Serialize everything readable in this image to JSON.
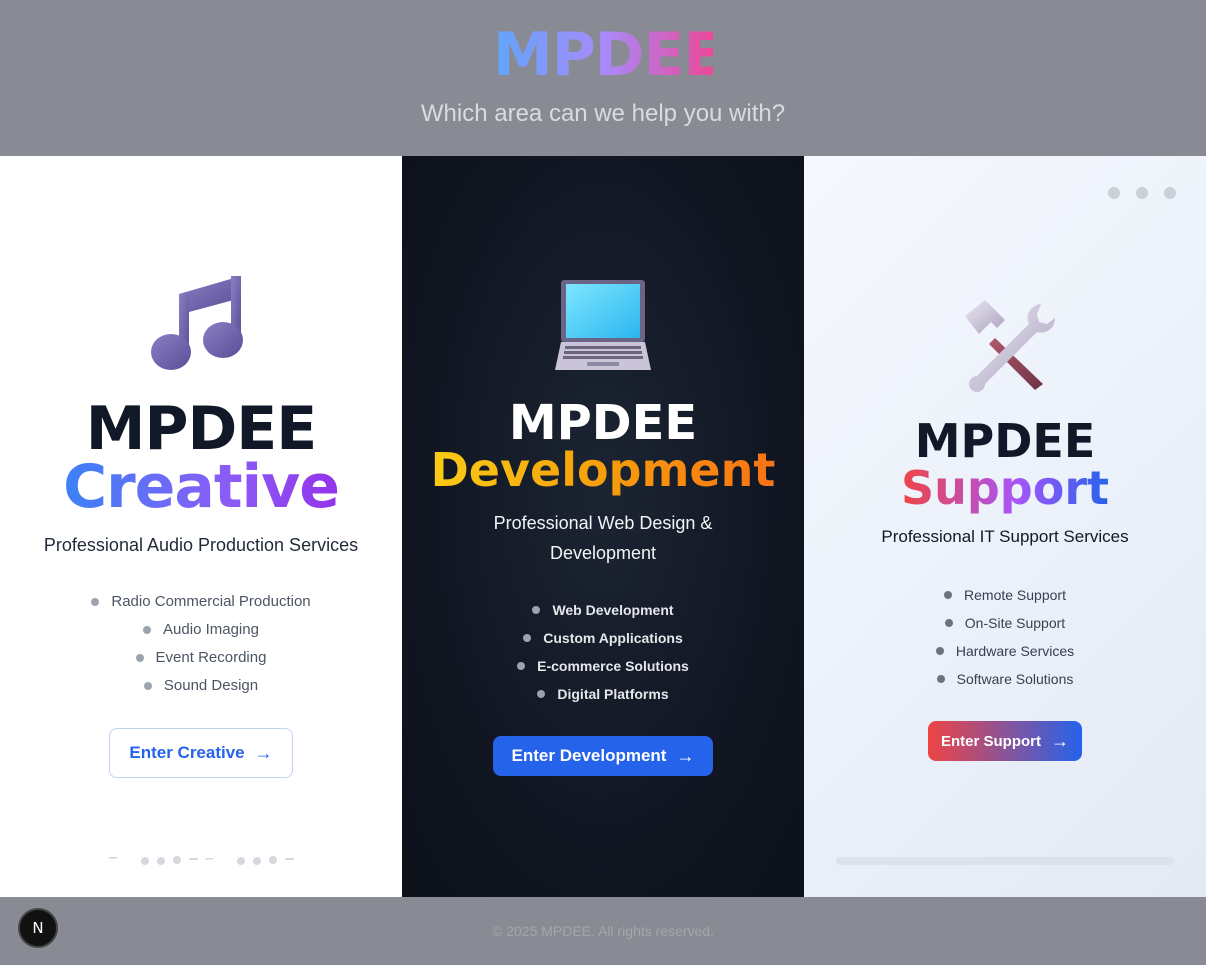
{
  "header": {
    "brand": "MPDEE",
    "tagline": "Which area can we help you with?"
  },
  "panels": {
    "creative": {
      "icon": "musical-note-icon",
      "title": "MPDEE",
      "name": "Creative",
      "subtitle": "Professional Audio Production Services",
      "services": [
        "Radio Commercial Production",
        "Audio Imaging",
        "Event Recording",
        "Sound Design"
      ],
      "button": "Enter Creative",
      "button_arrow": "→"
    },
    "development": {
      "icon": "laptop-icon",
      "title": "MPDEE",
      "name": "Development",
      "subtitle": "Professional Web Design & Development",
      "services": [
        "Web Development",
        "Custom Applications",
        "E-commerce Solutions",
        "Digital Platforms"
      ],
      "button": "Enter Development",
      "button_arrow": "→"
    },
    "support": {
      "icon": "hammer-and-wrench-icon",
      "title": "MPDEE",
      "name": "Support",
      "subtitle": "Professional IT Support Services",
      "services": [
        "Remote Support",
        "On-Site Support",
        "Hardware Services",
        "Software Solutions"
      ],
      "button": "Enter Support",
      "button_arrow": "→"
    }
  },
  "footer": {
    "copyright": "© 2025 MPDEE. All rights reserved."
  },
  "badge": {
    "letter": "N"
  },
  "colors": {
    "primary_blue": "#2563eb",
    "dev_accent": "#f59e0b",
    "support_red": "#ef4444",
    "creative_purple": "#8b5cf6"
  }
}
